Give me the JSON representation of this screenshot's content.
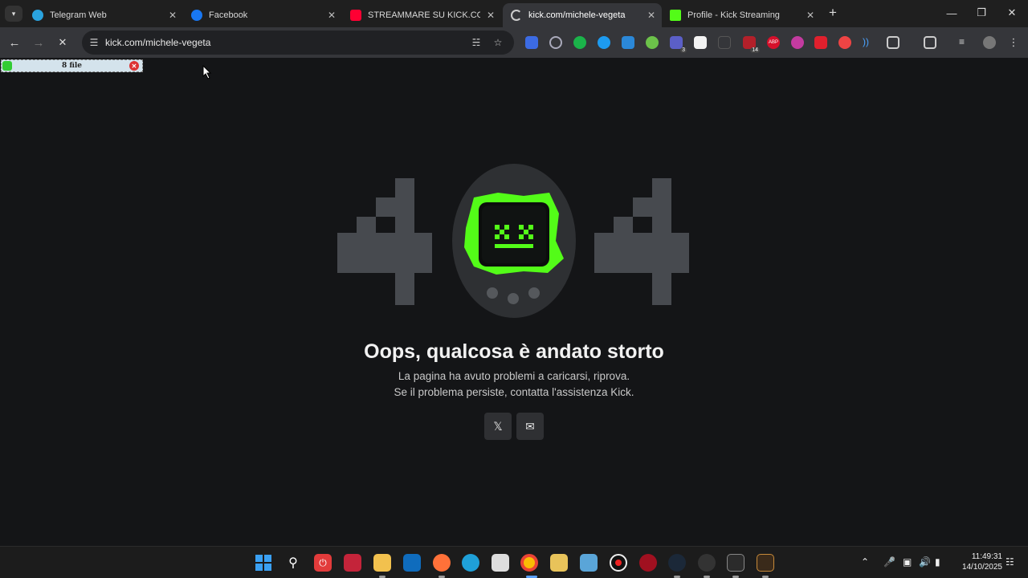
{
  "tabs": [
    {
      "label": "Telegram Web",
      "favicon": "telegram-icon",
      "color": "#2aa3df"
    },
    {
      "label": "Facebook",
      "favicon": "facebook-icon",
      "color": "#1877f2"
    },
    {
      "label": "STREAMMARE SU KICK.COM C",
      "favicon": "youtube-icon",
      "color": "#ff0033"
    },
    {
      "label": "kick.com/michele-vegeta",
      "favicon": "loading-spinner-icon",
      "color": "#cccccc"
    },
    {
      "label": "Profile - Kick Streaming",
      "favicon": "kick-icon",
      "color": "#53fc18"
    }
  ],
  "address_bar": {
    "url": "kick.com/michele-vegeta"
  },
  "download_bar": {
    "label": "8 file"
  },
  "page": {
    "title": "Oops, qualcosa è andato storto",
    "line1": "La pagina ha avuto problemi a caricarsi, riprova.",
    "line2": "Se il problema persiste, contatta l'assistenza Kick.",
    "error_code_left": "4",
    "error_code_right": "4",
    "accent_color": "#53fc18"
  },
  "taskbar": {
    "time": "11:49:31",
    "date": "14/10/2025"
  },
  "extensions": {
    "badge_count_a": "3",
    "badge_count_b": "14",
    "abp_label": "ABP"
  }
}
